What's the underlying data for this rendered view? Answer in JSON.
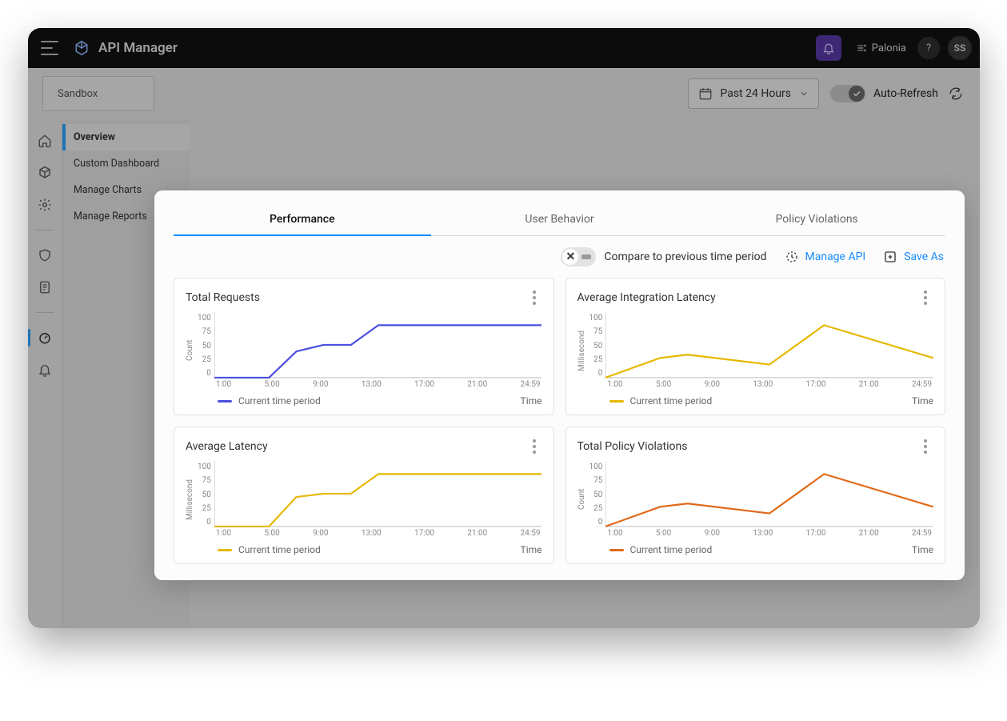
{
  "header": {
    "app_title": "API Manager",
    "org_name": "Palonia",
    "help": "?",
    "avatar_initials": "SS"
  },
  "toolbar": {
    "environment": "Sandbox",
    "range_label": "Past 24 Hours",
    "autorefresh_label": "Auto-Refresh",
    "autorefresh_on": true
  },
  "subnav": {
    "items": [
      {
        "label": "Overview",
        "active": true
      },
      {
        "label": "Custom Dashboard",
        "active": false
      },
      {
        "label": "Manage Charts",
        "active": false
      },
      {
        "label": "Manage Reports",
        "active": false
      }
    ]
  },
  "panel": {
    "tabs": [
      {
        "label": "Performance",
        "active": true
      },
      {
        "label": "User Behavior",
        "active": false
      },
      {
        "label": "Policy Violations",
        "active": false
      }
    ],
    "compare_label": "Compare to previous time period",
    "compare_on": false,
    "manage_api_label": "Manage API",
    "save_as_label": "Save As"
  },
  "chart_meta": {
    "x_ticks": [
      "1:00",
      "5:00",
      "9:00",
      "13:00",
      "17:00",
      "21:00",
      "24:59"
    ],
    "y_ticks": [
      "100",
      "75",
      "50",
      "25",
      "0"
    ],
    "legend_label": "Current time period",
    "xaxis_label": "Time"
  },
  "charts": [
    {
      "title": "Total Requests",
      "ylabel": "Count",
      "color": "#4b4fe0"
    },
    {
      "title": "Average Integration Latency",
      "ylabel": "Millisecond",
      "color": "#e6b800"
    },
    {
      "title": "Average Latency",
      "ylabel": "Millisecond",
      "color": "#e6b800"
    },
    {
      "title": "Total Policy Violations",
      "ylabel": "Count",
      "color": "#e06a1a"
    }
  ],
  "chart_data": [
    {
      "type": "line",
      "title": "Total Requests",
      "xlabel": "Time",
      "ylabel": "Count",
      "ylim": [
        0,
        100
      ],
      "series": [
        {
          "name": "Current time period",
          "x": [
            "1:00",
            "3:00",
            "5:00",
            "7:00",
            "9:00",
            "11:00",
            "13:00",
            "17:00",
            "21:00",
            "24:59"
          ],
          "values": [
            0,
            0,
            0,
            40,
            50,
            50,
            80,
            80,
            80,
            80
          ]
        }
      ]
    },
    {
      "type": "line",
      "title": "Average Integration Latency",
      "xlabel": "Time",
      "ylabel": "Millisecond",
      "ylim": [
        0,
        100
      ],
      "series": [
        {
          "name": "Current time period",
          "x": [
            "1:00",
            "5:00",
            "7:00",
            "13:00",
            "17:00",
            "24:59"
          ],
          "values": [
            0,
            30,
            35,
            20,
            80,
            30
          ]
        }
      ]
    },
    {
      "type": "line",
      "title": "Average Latency",
      "xlabel": "Time",
      "ylabel": "Millisecond",
      "ylim": [
        0,
        100
      ],
      "series": [
        {
          "name": "Current time period",
          "x": [
            "1:00",
            "3:00",
            "5:00",
            "7:00",
            "9:00",
            "11:00",
            "13:00",
            "17:00",
            "21:00",
            "24:59"
          ],
          "values": [
            0,
            0,
            0,
            45,
            50,
            50,
            80,
            80,
            80,
            80
          ]
        }
      ]
    },
    {
      "type": "line",
      "title": "Total Policy Violations",
      "xlabel": "Time",
      "ylabel": "Count",
      "ylim": [
        0,
        100
      ],
      "series": [
        {
          "name": "Current time period",
          "x": [
            "1:00",
            "5:00",
            "7:00",
            "13:00",
            "17:00",
            "24:59"
          ],
          "values": [
            0,
            30,
            35,
            20,
            80,
            30
          ]
        }
      ]
    }
  ]
}
